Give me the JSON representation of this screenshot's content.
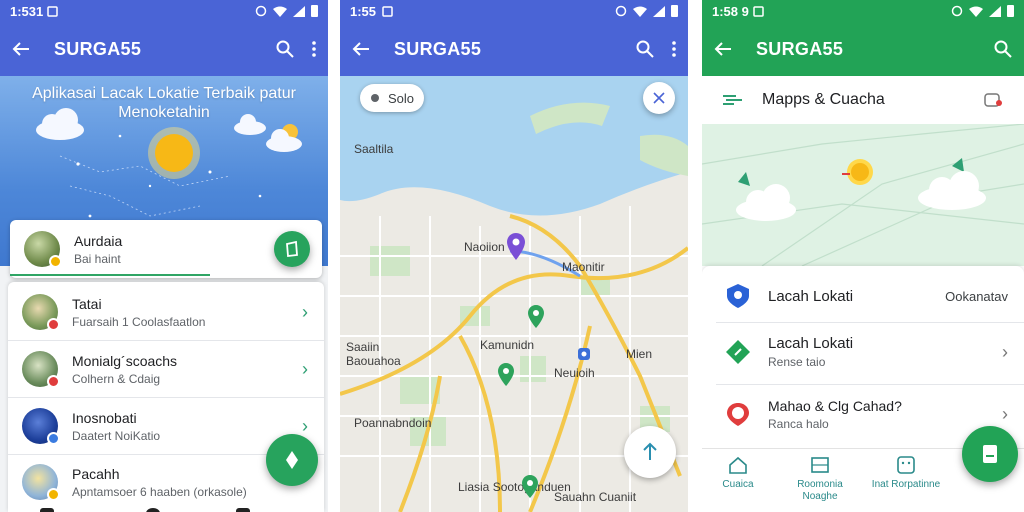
{
  "colors": {
    "blue_bar": "#4a64d6",
    "green_bar": "#22a356",
    "accent_green": "#27a35d"
  },
  "phone1": {
    "status_time": "1:531",
    "app_title": "SURGA55",
    "hero_title": "Aplikasai Lacak Lokatie Terbaik patur Menoketahin",
    "card": {
      "title": "Aurdaia",
      "subtitle": "Bai haint"
    },
    "items": [
      {
        "title": "Tatai",
        "subtitle": "Fuarsaih 1 Coolasfaatlon"
      },
      {
        "title": "Monialg´scoachs",
        "subtitle": "Colhern & Cdaig"
      },
      {
        "title": "Inosnobati",
        "subtitle": "Daatert NoiKatio"
      },
      {
        "title": "Pacahh",
        "subtitle": "Apntamsoer 6 haaben (orkasole)"
      }
    ]
  },
  "phone2": {
    "status_time": "1:55",
    "app_title": "SURGA55",
    "search_chip": "Solo",
    "map_labels": [
      "Saaltila",
      "Naoiion",
      "Maonitir",
      "Kamunidn",
      "Saaiin",
      "Baouahoa",
      "Neuioih",
      "Mien",
      "Poannabndoin",
      "Liasia Sootoganduen",
      "Sauahn Cuaniit"
    ]
  },
  "phone3": {
    "status_time": "1:58 9",
    "app_title": "SURGA55",
    "header_title": "Mapps & Cuacha",
    "rows": [
      {
        "title": "Lacah Lokati",
        "trailing": "Ookanatav",
        "subtitle": ""
      },
      {
        "title": "Lacah Lokati",
        "trailing": "",
        "subtitle": "Rense taio"
      },
      {
        "title": "Mahao & Clg Cahad?",
        "trailing": "",
        "subtitle": "Ranca halo"
      }
    ],
    "nav": [
      {
        "label": "Cuaica"
      },
      {
        "label": "Roomonia Noaghe"
      },
      {
        "label": "Inat Rorpatinne"
      }
    ]
  }
}
